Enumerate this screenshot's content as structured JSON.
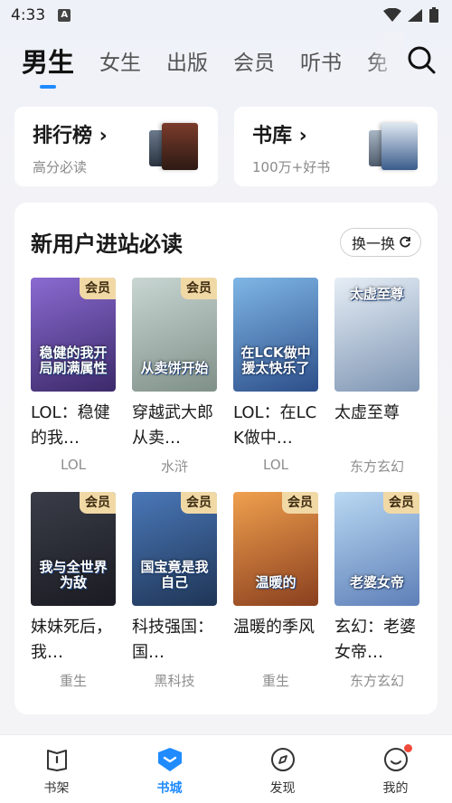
{
  "status": {
    "time": "4:33"
  },
  "tabs": [
    "男生",
    "女生",
    "出版",
    "会员",
    "听书",
    "免"
  ],
  "entries": [
    {
      "title": "排行榜 ›",
      "subtitle": "高分必读"
    },
    {
      "title": "书库 ›",
      "subtitle": "100万+好书"
    }
  ],
  "section": {
    "title": "新用户进站必读",
    "refresh_label": "换一换",
    "books": [
      {
        "title": "LOL：稳健的我…",
        "tag": "LOL",
        "vip": "会员",
        "cover_text": "稳健的我开局刷满属性",
        "color1": "#8a6ad1",
        "color2": "#3c2a6a"
      },
      {
        "title": "穿越武大郎从卖…",
        "tag": "水浒",
        "vip": "会员",
        "cover_text": "从卖饼开始",
        "color1": "#c9d6d3",
        "color2": "#7f9088"
      },
      {
        "title": "LOL：在LCK做中…",
        "tag": "LOL",
        "vip": "",
        "cover_text": "在LCK做中援太快乐了",
        "color1": "#7fb6e6",
        "color2": "#2d4f8a"
      },
      {
        "title": "太虚至尊",
        "tag": "东方玄幻",
        "vip": "",
        "cover_text": "太虚至尊",
        "color1": "#e6eef6",
        "color2": "#7e95b3"
      },
      {
        "title": "妹妹死后，我…",
        "tag": "重生",
        "vip": "会员",
        "cover_text": "我与全世界为敌",
        "color1": "#3a3d48",
        "color2": "#1a1b22"
      },
      {
        "title": "科技强国：国…",
        "tag": "黑科技",
        "vip": "会员",
        "cover_text": "国宝竟是我自己",
        "color1": "#4a78b8",
        "color2": "#1f3556"
      },
      {
        "title": "温暖的季风",
        "tag": "重生",
        "vip": "会员",
        "cover_text": "温暖的",
        "color1": "#f0a04e",
        "color2": "#8a3f1e"
      },
      {
        "title": "玄幻：老婆女帝…",
        "tag": "东方玄幻",
        "vip": "会员",
        "cover_text": "老婆女帝",
        "color1": "#b9d8f2",
        "color2": "#5e7fb8"
      }
    ]
  },
  "nav": [
    {
      "label": "书架",
      "icon": "bookshelf-icon"
    },
    {
      "label": "书城",
      "icon": "bookstore-icon"
    },
    {
      "label": "发现",
      "icon": "compass-icon"
    },
    {
      "label": "我的",
      "icon": "profile-icon"
    }
  ],
  "colors": {
    "accent": "#1f8bff",
    "vip_badge": "#f1d9a6",
    "notify_dot": "#f04a3a"
  }
}
